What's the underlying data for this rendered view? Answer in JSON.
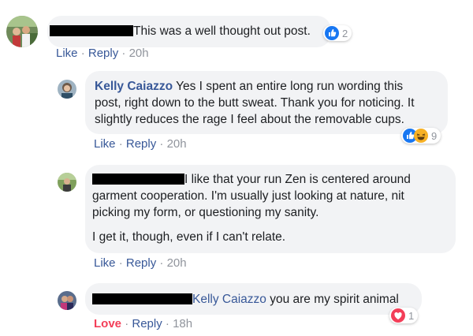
{
  "comments": [
    {
      "text": "This was a well thought out post.",
      "reactions": {
        "count": "2",
        "icons": [
          "like-icon"
        ]
      },
      "actions": {
        "like": "Like",
        "reply": "Reply",
        "time": "20h"
      }
    },
    {
      "author": "Kelly Caiazzo",
      "text_line1": " Yes I spent an entire long run wording this",
      "text_line2": "post, right down to the butt sweat. Thank you for noticing. It",
      "text_line3": "slightly reduces the rage I feel about the removable cups.",
      "reactions": {
        "count": "9",
        "icons": [
          "like-icon",
          "haha-icon"
        ]
      },
      "actions": {
        "like": "Like",
        "reply": "Reply",
        "time": "20h"
      }
    },
    {
      "text_line1": "I like that your run Zen is centered around",
      "text_line2": "garment cooperation. I'm usually just looking at nature, nit",
      "text_line3": "picking my form, or questioning my sanity.",
      "text_line4": "I get it, though, even if I can't relate.",
      "actions": {
        "like": "Like",
        "reply": "Reply",
        "time": "20h"
      }
    },
    {
      "mention": "Kelly Caiazzo",
      "text": " you are my spirit animal",
      "reactions": {
        "count": "1",
        "icons": [
          "love-icon"
        ]
      },
      "actions": {
        "love": "Love",
        "reply": "Reply",
        "time": "18h"
      }
    }
  ],
  "separator": "·",
  "colors": {
    "link": "#385898",
    "bubble": "#f2f3f5",
    "meta": "#90949c",
    "love": "#f33e58",
    "like": "#1877f2",
    "haha": "#f7b125"
  }
}
